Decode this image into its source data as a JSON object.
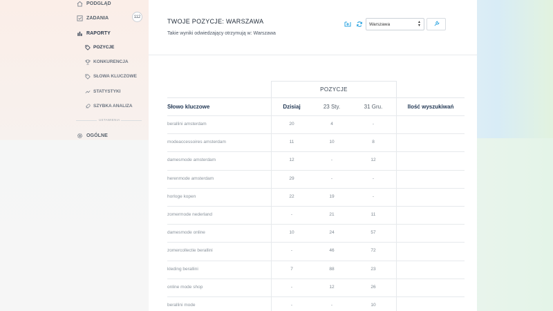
{
  "sidebar": {
    "items": [
      {
        "label": "PODGLĄD",
        "icon": "home-icon"
      },
      {
        "label": "ZADANIA",
        "icon": "checkbox-icon",
        "badge": "112"
      },
      {
        "label": "RAPORTY",
        "icon": "bar-chart-icon"
      }
    ],
    "sub_items": [
      {
        "label": "POZYCJE",
        "icon": "tag-icon"
      },
      {
        "label": "KONKURENCJA",
        "icon": "trophy-icon"
      },
      {
        "label": "SŁOWA KLUCZOWE",
        "icon": "tag-icon"
      },
      {
        "label": "STATYSTYKI",
        "icon": "trend-icon"
      },
      {
        "label": "SZYBKA ANALIZA",
        "icon": "rocket-icon"
      }
    ],
    "divider_label": "USTAWIENIA",
    "settings_item": {
      "label": "OGÓLNE",
      "icon": "gear-icon"
    }
  },
  "main": {
    "title": "TWOJE POZYCJE: WARSZAWA",
    "subtitle": "Takie wyniki odwiedzający otrzymują w: Warszawa",
    "location_select": "Warszawa",
    "accent_color": "#2aa3e0"
  },
  "table": {
    "group_header": "POZYCJE",
    "columns": [
      "Słowo kluczowe",
      "Dzisiaj",
      "23 Sty.",
      "31 Gru.",
      "Ilość wyszukiwań"
    ],
    "rows": [
      {
        "keyword": "berallini amsterdam",
        "today": "20",
        "d1": "4",
        "d2": "-",
        "volume": ""
      },
      {
        "keyword": "modeaccessoires amsterdam",
        "today": "11",
        "d1": "10",
        "d2": "8",
        "volume": ""
      },
      {
        "keyword": "damesmode amsterdam",
        "today": "12",
        "d1": "-",
        "d2": "12",
        "volume": ""
      },
      {
        "keyword": "herenmode amsterdam",
        "today": "29",
        "d1": "-",
        "d2": "-",
        "volume": ""
      },
      {
        "keyword": "horloge kopen",
        "today": "22",
        "d1": "19",
        "d2": "-",
        "volume": ""
      },
      {
        "keyword": "zomermode nederland",
        "today": "-",
        "d1": "21",
        "d2": "11",
        "volume": ""
      },
      {
        "keyword": "damesmode online",
        "today": "10",
        "d1": "24",
        "d2": "57",
        "volume": ""
      },
      {
        "keyword": "zomercollectie berallini",
        "today": "-",
        "d1": "46",
        "d2": "72",
        "volume": ""
      },
      {
        "keyword": "kleding berallini",
        "today": "7",
        "d1": "88",
        "d2": "23",
        "volume": ""
      },
      {
        "keyword": "online mode shop",
        "today": "-",
        "d1": "12",
        "d2": "26",
        "volume": ""
      },
      {
        "keyword": "berallini mode",
        "today": "-",
        "d1": "-",
        "d2": "10",
        "volume": ""
      }
    ]
  }
}
